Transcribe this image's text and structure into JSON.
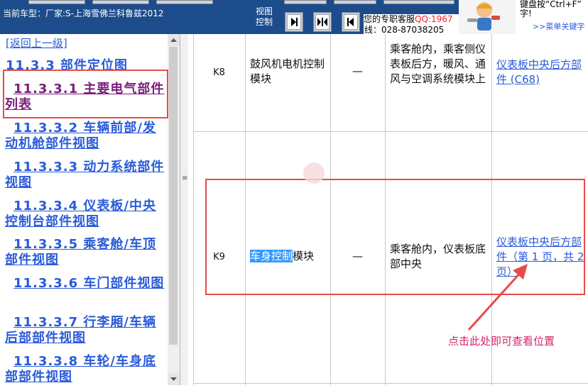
{
  "topbar": {
    "vehicle_label": "当前车型：厂家:S-上海雪佛兰科鲁兹2012",
    "view_control_label": "视图控制",
    "service_prefix": "您的专职客服",
    "service_qq": "QQ:1967",
    "service_tel": "线：028-87038205",
    "tip_line1": "键盘按“Ctrl+F”",
    "tip_line2": "字!",
    "tip_link": ">>菜单关键字"
  },
  "sidebar": {
    "back_link": "[返回上一级]",
    "section_title": "11.3.3 部件定位图",
    "items": [
      {
        "label": "11.3.3.1 主要电气部件列表"
      },
      {
        "label": "11.3.3.2 车辆前部/发动机舱部件视图"
      },
      {
        "label": "11.3.3.3 动力系统部件视图"
      },
      {
        "label": "11.3.3.4 仪表板/中央控制台部件视图"
      },
      {
        "label": "11.3.3.5 乘客舱/车顶部件视图"
      },
      {
        "label": "11.3.3.6 车门部件视图"
      },
      {
        "label": "11.3.3.7 行李厢/车辆后部部件视图"
      },
      {
        "label": "11.3.3.8 车轮/车身底部部件视图"
      }
    ]
  },
  "table": {
    "rows": [
      {
        "id": "K8",
        "name": "鼓风机电机控制模块",
        "option": "—",
        "location": "乘客舱内，乘客侧仪表板后方，暖风、通风与空调系统模块上",
        "view": "仪表板中央后方部件 (C68)"
      },
      {
        "id": "K9",
        "name_selected": "车身控制",
        "name_rest": "模块",
        "option": "—",
        "location": "乘客舱内，仪表板底部中央",
        "view": "仪表板中央后方部件（第 1 页，共 2 页）"
      }
    ]
  },
  "annotation": {
    "text": "点击此处即可查看位置"
  },
  "colors": {
    "topbar_bg": "#1c4c8c",
    "link": "#2a5bd7",
    "visited_link": "#7b1e7b",
    "annotation_red": "#e84a4a",
    "annotation_text": "#d6226a",
    "selection": "#3399ff"
  }
}
